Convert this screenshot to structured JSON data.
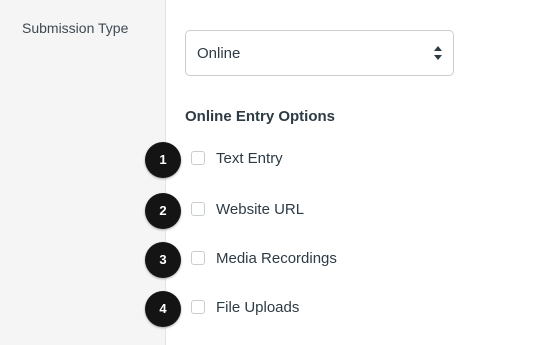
{
  "submission": {
    "label": "Submission Type",
    "selected": "Online"
  },
  "online_entry": {
    "heading": "Online Entry Options",
    "options": [
      {
        "marker": "1",
        "label": "Text Entry",
        "checked": false
      },
      {
        "marker": "2",
        "label": "Website URL",
        "checked": false
      },
      {
        "marker": "3",
        "label": "Media Recordings",
        "checked": false
      },
      {
        "marker": "4",
        "label": "File Uploads",
        "checked": false
      }
    ]
  }
}
